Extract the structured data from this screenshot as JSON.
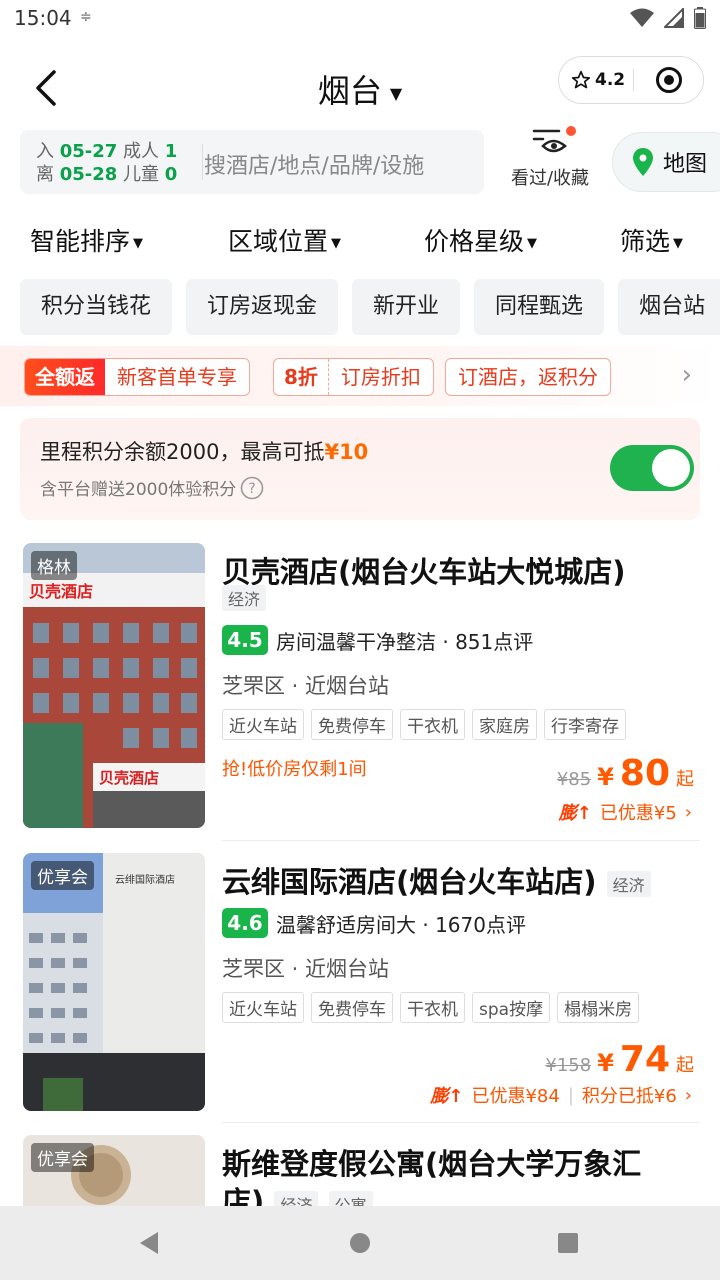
{
  "status_bar": {
    "time": "15:04",
    "extra": "≑"
  },
  "header": {
    "city": "烟台",
    "rating": "4.2"
  },
  "search": {
    "checkin_label": "入",
    "checkin_date": "05-27",
    "adult_label": "成人",
    "adult_count": "1",
    "checkout_label": "离",
    "checkout_date": "05-28",
    "child_label": "儿童",
    "child_count": "0",
    "placeholder": "搜酒店/地点/品牌/设施",
    "favorites_label": "看过/收藏",
    "map_label": "地图"
  },
  "sort": [
    "智能排序",
    "区域位置",
    "价格星级",
    "筛选"
  ],
  "chips": [
    "积分当钱花",
    "订房返现金",
    "新开业",
    "同程甄选",
    "烟台站"
  ],
  "promo": {
    "tag1_solid": "全额返",
    "tag1_text": "新客首单专享",
    "tag2_bold": "8折",
    "tag2_text": "订房折扣",
    "tag3_text": "订酒店，返积分"
  },
  "mileage": {
    "line1_prefix": "里程积分余额2000，最高可抵",
    "line1_amount": "¥10",
    "line2": "含平台赠送2000体验积分"
  },
  "hotels": [
    {
      "brand": "格林",
      "name": "贝壳酒店(烟台火车站大悦城店)",
      "category": "经济",
      "score": "4.5",
      "review_text": "房间温馨干净整洁 · 851点评",
      "location": "芝罘区 · 近烟台站",
      "tags": [
        "近火车站",
        "免费停车",
        "干衣机",
        "家庭房",
        "行李寄存"
      ],
      "urgent": "抢!低价房仅剩1间",
      "orig_price": "¥85",
      "yen": "¥",
      "price": "80",
      "qi": "起",
      "peng": "膨↑",
      "discount": "已优惠¥5",
      "points": ""
    },
    {
      "brand": "优享会",
      "name": "云绯国际酒店(烟台火车站店)",
      "category": "经济",
      "score": "4.6",
      "review_text": "温馨舒适房间大 · 1670点评",
      "location": "芝罘区 · 近烟台站",
      "tags": [
        "近火车站",
        "免费停车",
        "干衣机",
        "spa按摩",
        "榻榻米房"
      ],
      "urgent": "",
      "orig_price": "¥158",
      "yen": "¥",
      "price": "74",
      "qi": "起",
      "peng": "膨↑",
      "discount": "已优惠¥84",
      "points": "积分已抵¥6"
    },
    {
      "brand": "优享会",
      "name": "斯维登度假公寓(烟台大学万象汇",
      "name_cont": "店)",
      "category": "经济",
      "category2": "公寓"
    }
  ]
}
